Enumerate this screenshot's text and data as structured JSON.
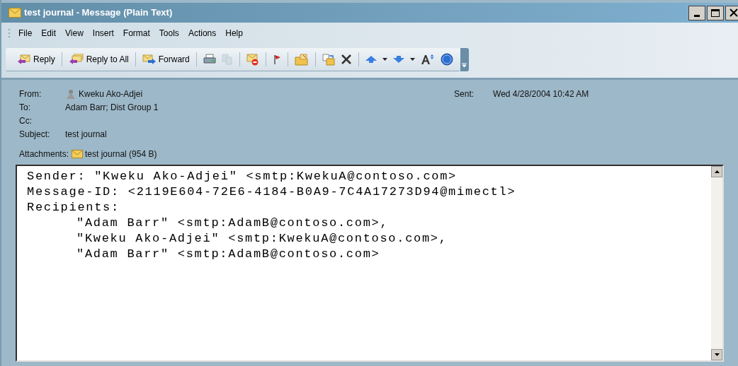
{
  "window": {
    "title": "test journal - Message (Plain Text)"
  },
  "menu": [
    "File",
    "Edit",
    "View",
    "Insert",
    "Format",
    "Tools",
    "Actions",
    "Help"
  ],
  "toolbar": [
    {
      "kind": "text",
      "label": "Reply"
    },
    {
      "kind": "sep"
    },
    {
      "kind": "text",
      "label": "Reply to All"
    },
    {
      "kind": "sep"
    },
    {
      "kind": "text",
      "label": "Forward"
    },
    {
      "kind": "sep"
    },
    {
      "kind": "icon",
      "disabled": false
    },
    {
      "kind": "icon",
      "disabled": true
    },
    {
      "kind": "sep"
    },
    {
      "kind": "icon",
      "disabled": false
    },
    {
      "kind": "sep"
    },
    {
      "kind": "icon",
      "disabled": false
    },
    {
      "kind": "sep"
    },
    {
      "kind": "icon",
      "disabled": false
    },
    {
      "kind": "sep"
    },
    {
      "kind": "icon",
      "disabled": false
    },
    {
      "kind": "icon",
      "disabled": false
    },
    {
      "kind": "sep"
    },
    {
      "kind": "icon",
      "disabled": false
    },
    {
      "kind": "icon",
      "disabled": false
    },
    {
      "kind": "icon",
      "disabled": false
    },
    {
      "kind": "icon",
      "disabled": false
    },
    {
      "kind": "icon",
      "disabled": false
    },
    {
      "kind": "icon",
      "disabled": false
    }
  ],
  "header": {
    "from_label": "From:",
    "from": "Kweku Ako-Adjei",
    "sent_label": "Sent:",
    "sent": "Wed 4/28/2004 10:42 AM",
    "to_label": "To:",
    "to": "Adam Barr; Dist Group 1",
    "cc_label": "Cc:",
    "subject_label": "Subject:",
    "subject": "test journal",
    "attachments_label": "Attachments:",
    "attachment": "test journal (954 B)"
  },
  "body": {
    "lines": [
      {
        "text": "Sender: \"Kweku Ako-Adjei\" <smtp:KwekuA@contoso.com>",
        "indented": false
      },
      {
        "text": "Message-ID: <2119E604-72E6-4184-B0A9-7C4A17273D94@mimectl>",
        "indented": false
      },
      {
        "text": "Recipients:",
        "indented": false
      },
      {
        "text": "\"Adam Barr\" <smtp:AdamB@contoso.com>,",
        "indented": true
      },
      {
        "text": "\"Kweku Ako-Adjei\" <smtp:KwekuA@contoso.com>,",
        "indented": true
      },
      {
        "text": "\"Adam Barr\" <smtp:AdamB@contoso.com>",
        "indented": true
      }
    ]
  }
}
